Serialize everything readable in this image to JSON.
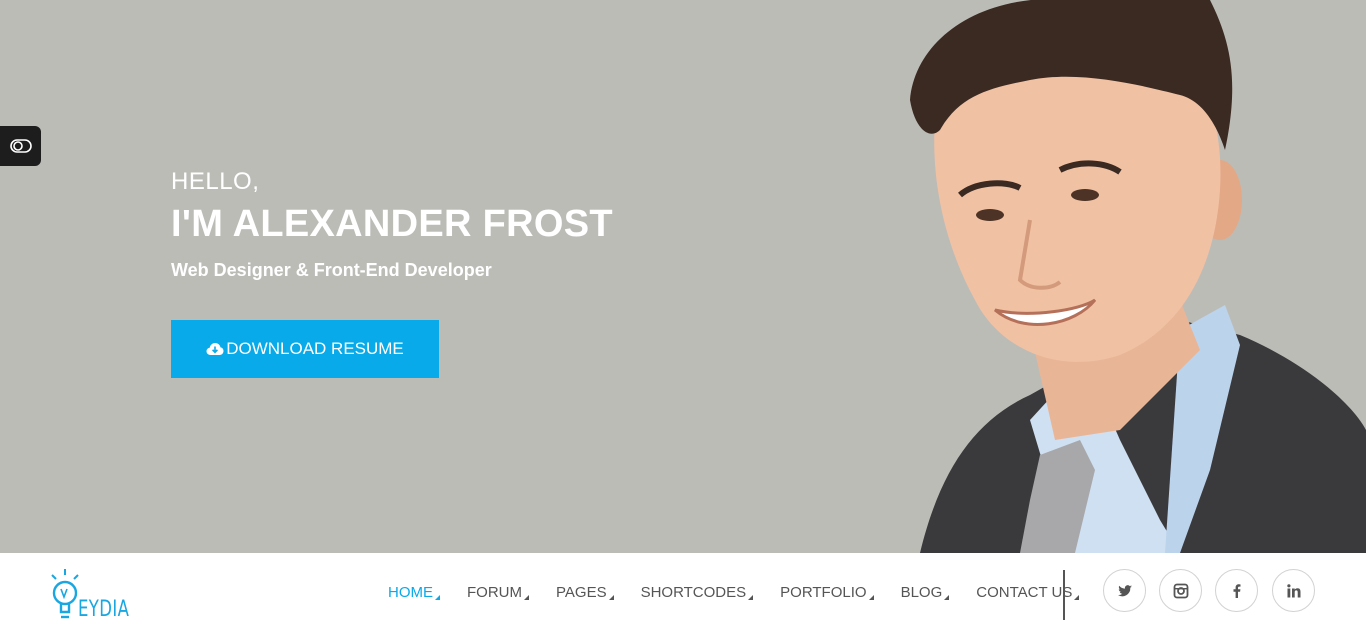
{
  "hero": {
    "greeting": "HELLO,",
    "name": "I'M ALEXANDER FROST",
    "role": "Web Designer & Front-End Developer",
    "download_label": "DOWNLOAD RESUME",
    "background_color": "#bcbcb7"
  },
  "brand": {
    "logo_text": "EYDIA",
    "accent_color": "#08aae9"
  },
  "nav": {
    "items": [
      {
        "label": "HOME",
        "active": true
      },
      {
        "label": "FORUM",
        "active": false
      },
      {
        "label": "PAGES",
        "active": false
      },
      {
        "label": "SHORTCODES",
        "active": false
      },
      {
        "label": "PORTFOLIO",
        "active": false
      },
      {
        "label": "BLOG",
        "active": false
      },
      {
        "label": "CONTACT US",
        "active": false
      }
    ]
  },
  "social": [
    "twitter-icon",
    "instagram-icon",
    "facebook-icon",
    "linkedin-icon"
  ]
}
